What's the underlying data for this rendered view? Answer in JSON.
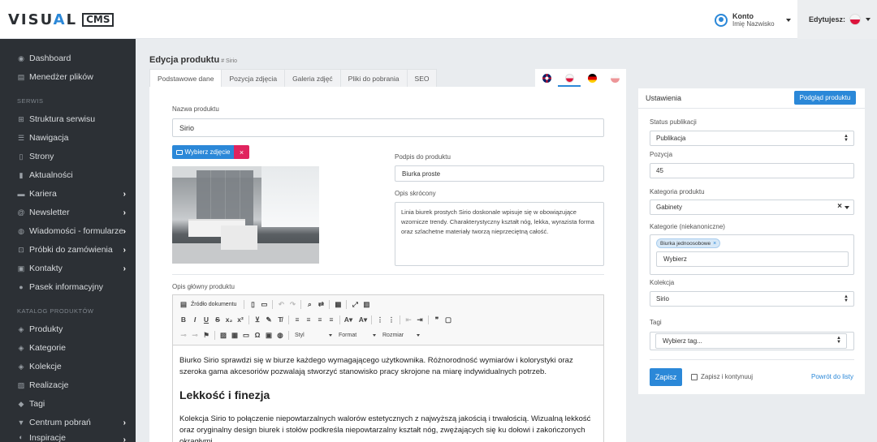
{
  "header": {
    "logo_main_pre": "VISU",
    "logo_main_accent": "A",
    "logo_main_post": "L",
    "logo_cms": "CMS",
    "account_title": "Konto",
    "account_name": "Imię Nazwisko",
    "editing_label": "Edytujesz:"
  },
  "sidebar": {
    "items_top": [
      {
        "label": "Dashboard",
        "icon": "palette-icon"
      },
      {
        "label": "Menedżer plików",
        "icon": "file-icon"
      }
    ],
    "section_serwis": "SERWIS",
    "items_serwis": [
      {
        "label": "Struktura serwisu",
        "icon": "sitemap-icon",
        "chevron": false
      },
      {
        "label": "Nawigacja",
        "icon": "list-icon",
        "chevron": false
      },
      {
        "label": "Strony",
        "icon": "page-icon",
        "chevron": false
      },
      {
        "label": "Aktualności",
        "icon": "news-icon",
        "chevron": false
      },
      {
        "label": "Kariera",
        "icon": "briefcase-icon",
        "chevron": true
      },
      {
        "label": "Newsletter",
        "icon": "at-icon",
        "chevron": true
      },
      {
        "label": "Wiadomości - formularze",
        "icon": "mail-icon",
        "chevron": true
      },
      {
        "label": "Próbki do zamówienia",
        "icon": "cart-icon",
        "chevron": true
      },
      {
        "label": "Kontakty",
        "icon": "address-book-icon",
        "chevron": true
      },
      {
        "label": "Pasek informacyjny",
        "icon": "info-icon",
        "chevron": false
      }
    ],
    "section_katalog": "KATALOG PRODUKTÓW",
    "items_katalog": [
      {
        "label": "Produkty",
        "icon": "cube-icon",
        "chevron": false
      },
      {
        "label": "Kategorie",
        "icon": "category-icon",
        "chevron": false
      },
      {
        "label": "Kolekcje",
        "icon": "collection-icon",
        "chevron": false
      },
      {
        "label": "Realizacje",
        "icon": "image-icon",
        "chevron": false
      },
      {
        "label": "Tagi",
        "icon": "tag-icon",
        "chevron": false
      },
      {
        "label": "Centrum pobrań",
        "icon": "download-icon",
        "chevron": true
      },
      {
        "label": "Inspiracje",
        "icon": "lightbulb-icon",
        "chevron": true
      }
    ]
  },
  "main": {
    "title": "Edycja produktu",
    "subtitle": "# Sirio",
    "tabs": [
      "Podstawowe dane",
      "Pozycja zdjęcia",
      "Galeria zdjęć",
      "Pliki do pobrania",
      "SEO"
    ],
    "product_name_label": "Nazwa produktu",
    "product_name_value": "Sirio",
    "pick_image_label": "Wybierz zdjęcie",
    "remove_label": "×",
    "caption_label": "Podpis do produktu",
    "caption_value": "Biurka proste",
    "short_desc_label": "Opis skrócony",
    "short_desc_value": "Linia biurek prostych Sirio doskonale wpisuje się w obowiązujące wzornicze trendy. Charakterystyczny kształt nóg, lekka, wyrazista forma oraz szlachetne materiały tworzą nieprzeciętną całość.",
    "main_desc_label": "Opis główny produktu",
    "editor": {
      "source_label": "Źródło dokumentu",
      "style_label": "Styl",
      "format_label": "Format",
      "size_label": "Rozmiar",
      "para1": "Biurko Sirio sprawdzi się w biurze każdego wymagającego użytkownika. Różnorodność wymiarów i kolorystyki oraz szeroka gama akcesoriów pozwalają stworzyć stanowisko pracy skrojone na miarę indywidualnych potrzeb.",
      "heading": "Lekkość i finezja",
      "para2": "Kolekcja Sirio to połączenie niepowtarzalnych walorów estetycznych z najwyższą jakością i trwałością. Wizualną lekkość oraz oryginalny design biurek i stołów podkreśla niepowtarzalny kształt nóg, zwężających się ku dołowi i zakończonych okrągłymi"
    }
  },
  "settings": {
    "title": "Ustawienia",
    "preview_button": "Podgląd produktu",
    "status_label": "Status publikacji",
    "status_value": "Publikacja",
    "position_label": "Pozycja",
    "position_value": "45",
    "category_label": "Kategoria produktu",
    "category_value": "Gabinety",
    "categories_label": "Kategorie (niekanoniczne)",
    "categories_chip": "Biurka jednoosobowe",
    "categories_input": "Wybierz",
    "collection_label": "Kolekcja",
    "collection_value": "Sirio",
    "tags_label": "Tagi",
    "tags_value": "Wybierz tag...",
    "save_button": "Zapisz",
    "save_continue": "Zapisz i kontynuuj",
    "back_link": "Powrót do listy"
  },
  "colors": {
    "accent": "#2b88d8",
    "danger": "#e0245e",
    "sidebar_bg": "#2c3035"
  }
}
